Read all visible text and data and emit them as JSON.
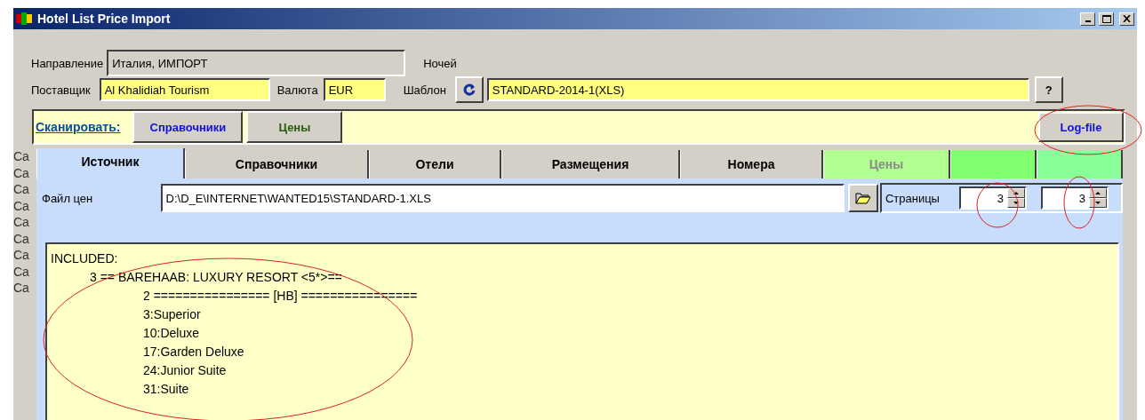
{
  "window": {
    "title": "Hotel List Price Import"
  },
  "fields": {
    "direction": {
      "label": "Направление",
      "value": "Италия, ИМПОРТ"
    },
    "nights": {
      "label": "Ночей"
    },
    "supplier": {
      "label": "Поставщик",
      "value": "Al Khalidiah Tourism"
    },
    "currency": {
      "label": "Валюта",
      "value": "EUR"
    },
    "template": {
      "label": "Шаблон",
      "value": "STANDARD-2014-1(XLS)",
      "help": "?"
    }
  },
  "scan_bar": {
    "link": "Сканировать:",
    "buttons": [
      {
        "label": "Справочники",
        "kind": "reference"
      },
      {
        "label": "Цены",
        "kind": "prices"
      }
    ],
    "log_button": "Log-file"
  },
  "background_labels": [
    "Ca",
    "Ca",
    "Ca",
    "Ca",
    "Ca",
    "Ca",
    "Ca",
    "Ca",
    "Ca"
  ],
  "tabs": [
    {
      "kind": "text",
      "label": "Источник",
      "selected": true,
      "disabled": false
    },
    {
      "kind": "text",
      "label": "Справочники",
      "selected": false,
      "disabled": false
    },
    {
      "kind": "text",
      "label": "Отели",
      "selected": false,
      "disabled": false
    },
    {
      "kind": "text",
      "label": "Размещения",
      "selected": false,
      "disabled": false
    },
    {
      "kind": "text",
      "label": "Номера",
      "selected": false,
      "disabled": false
    },
    {
      "kind": "text",
      "label": "Цены",
      "selected": false,
      "disabled": true,
      "color": "#b0ff90"
    },
    {
      "kind": "blank",
      "selected": false,
      "color": "#80ff70"
    },
    {
      "kind": "blank",
      "selected": false,
      "color": "#88ff99"
    }
  ],
  "source": {
    "file_label": "Файл цен",
    "file_value": "D:\\D_E\\INTERNET\\WANTED15\\STANDARD-1.XLS",
    "pages_label": "Страницы",
    "page_from": "3",
    "page_to": "3"
  },
  "log": [
    {
      "text": "INCLUDED:",
      "children": [
        {
          "text": "3 == BAREHAAB: LUXURY RESORT <5*>==",
          "children": [
            {
              "text": "2 ================ [HB] ================"
            },
            {
              "text": "3:Superior"
            },
            {
              "text": "10:Deluxe"
            },
            {
              "text": "17:Garden Deluxe"
            },
            {
              "text": "24:Junior Suite"
            },
            {
              "text": "31:Suite"
            }
          ]
        }
      ]
    }
  ]
}
